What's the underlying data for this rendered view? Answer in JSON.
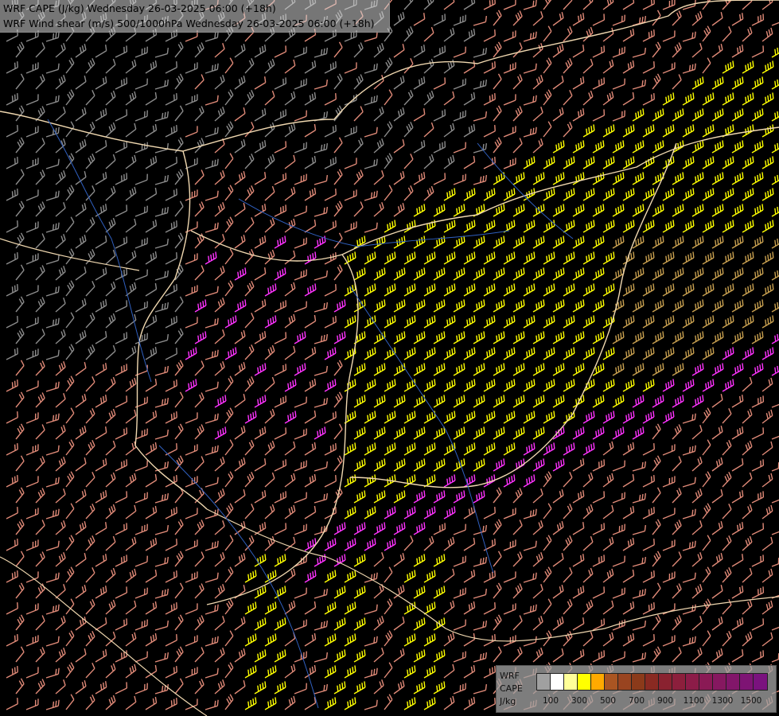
{
  "header": {
    "title_line1": "WRF CAPE (J/kg) Wednesday 26-03-2025 06:00 (+18h)",
    "title_line2": "WRF Wind shear (m/s) 500/1000hPa Wednesday 26-03-2025 06:00 (+18h)"
  },
  "legend": {
    "line1": "WRF",
    "line2": "CAPE",
    "line3": "J/kg",
    "colors": [
      "#a0a0a0",
      "#ffffff",
      "#ffff99",
      "#ffff00",
      "#ffaa00",
      "#aa5522",
      "#994420",
      "#8b3a1a",
      "#8a2a22",
      "#8a2230",
      "#8c1f3c",
      "#8c1c48",
      "#8a1a55",
      "#861860",
      "#82166a",
      "#7e1474",
      "#7a127e"
    ],
    "tick_labels": [
      "100",
      "300",
      "500",
      "700",
      "900",
      "1100",
      "1300",
      "1500"
    ]
  },
  "map": {
    "shear_colors": {
      "grey": "#8c8c8c",
      "salmon": "#e08a78",
      "yellow": "#ffff00",
      "tan": "#c8a050",
      "magenta": "#ff33ff"
    },
    "border_color": "#f0d8b0",
    "river_color": "#3060c0"
  }
}
